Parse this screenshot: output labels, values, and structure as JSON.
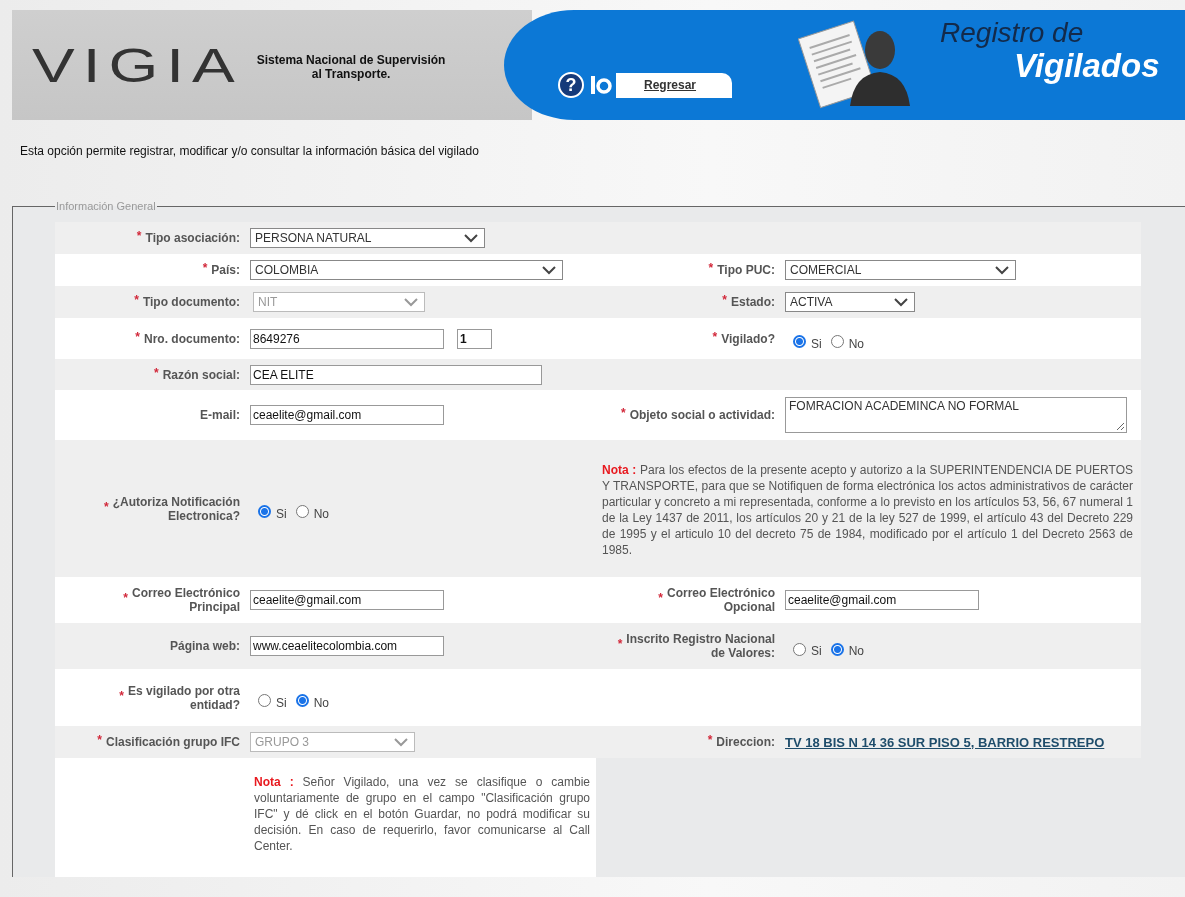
{
  "header": {
    "logo": "VIGIA",
    "tagline_lines": [
      "Sistema Nacional de Supervisión",
      "al Transporte."
    ],
    "help": "?",
    "back_link": "Regresar",
    "title_lines": [
      "Registro de",
      "Vigilados"
    ]
  },
  "intro": "Esta opción permite registrar, modificar y/o consultar la información básica del vigilado",
  "section": {
    "legend": "Información General",
    "rows": [
      {
        "kind": "fields",
        "left": {
          "required_mark": "*",
          "label": "Tipo asociación:",
          "field": {
            "kind": "select",
            "value": "PERSONA NATURAL",
            "disabled": false
          }
        }
      },
      {
        "kind": "fields",
        "left": {
          "required_mark": "*",
          "label": "País:",
          "field": {
            "kind": "select",
            "value": "COLOMBIA",
            "disabled": false
          }
        },
        "right": {
          "required_mark": "*",
          "label": "Tipo PUC:",
          "field": {
            "kind": "select",
            "value": "COMERCIAL",
            "disabled": false
          }
        }
      },
      {
        "kind": "fields",
        "left": {
          "required_mark": "*",
          "label": "Tipo documento:",
          "field": {
            "kind": "select",
            "value": "NIT",
            "disabled": true
          }
        },
        "right": {
          "required_mark": "*",
          "label": "Estado:",
          "field": {
            "kind": "select",
            "value": "ACTIVA",
            "disabled": false
          }
        }
      },
      {
        "kind": "fields",
        "left": {
          "required_mark": "*",
          "label": "Nro. documento:",
          "field": {
            "kind": "text_pair",
            "values": [
              "8649276",
              "1"
            ]
          }
        },
        "right": {
          "required_mark": "*",
          "label": "Vigilado?",
          "field": {
            "kind": "radio",
            "options": [
              {
                "label": "Si",
                "selected": true
              },
              {
                "label": "No",
                "selected": false
              }
            ]
          }
        }
      },
      {
        "kind": "fields",
        "left": {
          "required_mark": "*",
          "label": "Razón social:",
          "field": {
            "kind": "text",
            "value": "CEA ELITE"
          }
        }
      },
      {
        "kind": "fields",
        "left": {
          "label": "E-mail:",
          "field": {
            "kind": "text",
            "value": "ceaelite@gmail.com"
          }
        },
        "right": {
          "required_mark": "*",
          "label": "Objeto social o actividad:",
          "field": {
            "kind": "textarea",
            "value": "FOMRACION ACADEMINCA NO FORMAL"
          }
        }
      },
      {
        "kind": "fields",
        "left": {
          "required_mark": "*",
          "label": "¿Autoriza Notificación\nElectronica?",
          "field": {
            "kind": "radio",
            "options": [
              {
                "label": "Si",
                "selected": true
              },
              {
                "label": "No",
                "selected": false
              }
            ]
          }
        },
        "right": {
          "field": {
            "kind": "note",
            "lead": "Nota :",
            "text": "Para los efectos de la presente acepto y autorizo a la SUPERINTENDENCIA DE PUERTOS Y TRANSPORTE, para que se Notifiquen de forma electrónica los actos administrativos de carácter particular y concreto a mi representada, conforme a lo previsto en los artículos 53, 56, 67 numeral 1 de la Ley 1437 de 2011, los artículos 20 y 21 de la ley 527 de 1999, el artículo 43 del Decreto 229 de 1995 y el articulo 10 del decreto 75 de 1984, modificado por el artículo 1 del Decreto 2563 de 1985."
          }
        }
      },
      {
        "kind": "fields",
        "left": {
          "required_mark": "*",
          "label": "Correo Electrónico\nPrincipal",
          "field": {
            "kind": "text",
            "value": "ceaelite@gmail.com"
          }
        },
        "right": {
          "required_mark": "*",
          "label": "Correo Electrónico\nOpcional",
          "field": {
            "kind": "text",
            "value": "ceaelite@gmail.com"
          }
        }
      },
      {
        "kind": "fields",
        "left": {
          "label": "Página web:",
          "field": {
            "kind": "text",
            "value": "www.ceaelitecolombia.com"
          }
        },
        "right": {
          "required_mark": "*",
          "label": "Inscrito Registro Nacional\nde Valores:",
          "field": {
            "kind": "radio",
            "options": [
              {
                "label": "Si",
                "selected": false
              },
              {
                "label": "No",
                "selected": true
              }
            ]
          }
        }
      },
      {
        "kind": "fields",
        "left": {
          "required_mark": "*",
          "label": "Es vigilado por otra\nentidad?",
          "field": {
            "kind": "radio",
            "options": [
              {
                "label": "Si",
                "selected": false
              },
              {
                "label": "No",
                "selected": true
              }
            ]
          }
        }
      },
      {
        "kind": "fields",
        "left": {
          "required_mark": "*",
          "label": "Clasificación grupo IFC",
          "field": {
            "kind": "select",
            "value": "GRUPO 3",
            "disabled": true
          }
        },
        "right": {
          "required_mark": "*",
          "label": "Direccion:",
          "field": {
            "kind": "link",
            "value": "TV 18 BIS N 14 36 SUR PISO 5, BARRIO RESTREPO"
          }
        }
      },
      {
        "kind": "note",
        "left": {
          "field": {
            "kind": "note",
            "lead": "Nota :",
            "text": "Señor Vigilado, una vez se clasifique o cambie voluntariamente de grupo en el campo \"Clasificación grupo IFC\" y dé click en el botón Guardar, no podrá modificar su decisión. En caso de requerirlo, favor comunicarse al Call Center."
          }
        }
      }
    ]
  }
}
